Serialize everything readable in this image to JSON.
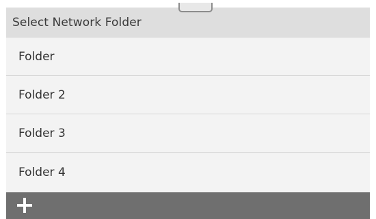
{
  "header": {
    "title": "Select Network Folder"
  },
  "folders": [
    {
      "label": "Folder"
    },
    {
      "label": "Folder 2"
    },
    {
      "label": "Folder 3"
    },
    {
      "label": "Folder 4"
    }
  ],
  "bottom_bar": {
    "add_icon": "plus-icon"
  },
  "colors": {
    "header_bg": "#dedede",
    "list_bg": "#f3f3f3",
    "bottom_bar_bg": "#6f6f6f"
  }
}
